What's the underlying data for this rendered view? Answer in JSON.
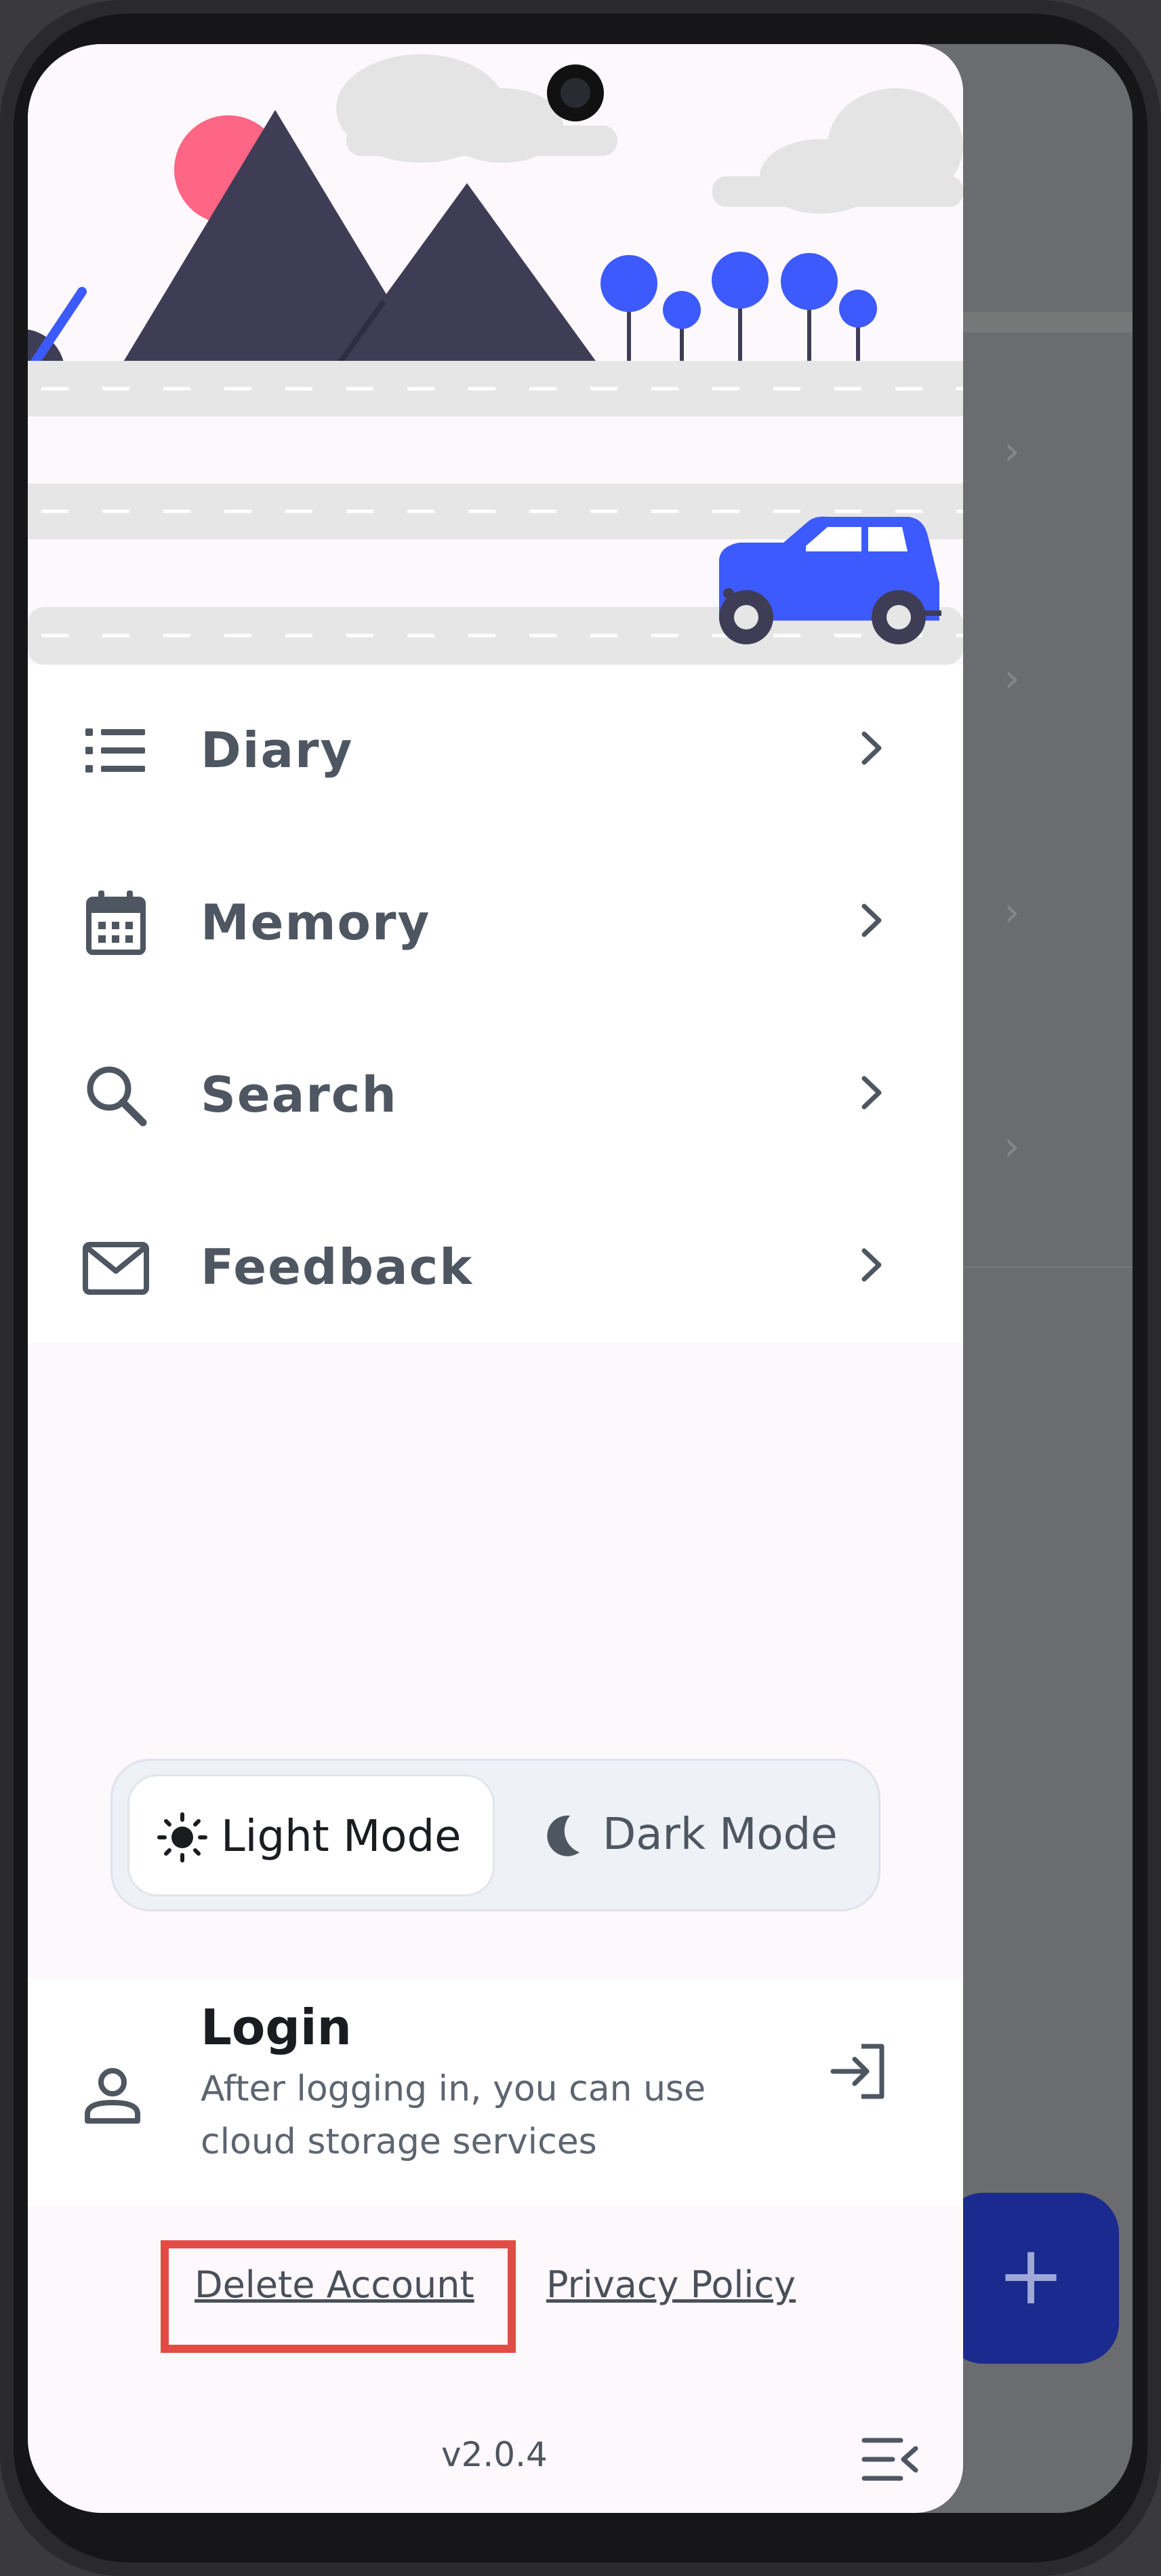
{
  "drawer": {
    "menu": [
      {
        "label": "Diary",
        "icon": "list-icon"
      },
      {
        "label": "Memory",
        "icon": "calendar-icon"
      },
      {
        "label": "Search",
        "icon": "search-icon"
      },
      {
        "label": "Feedback",
        "icon": "mail-icon"
      }
    ],
    "theme": {
      "light_label": "Light Mode",
      "dark_label": "Dark Mode",
      "selected": "Light Mode"
    },
    "login": {
      "title": "Login",
      "subtitle": "After logging in, you can use cloud storage services"
    },
    "links": {
      "delete_account": "Delete Account",
      "privacy_policy": "Privacy Policy"
    },
    "version": "v2.0.4"
  },
  "fab": {
    "label": "+"
  },
  "colors": {
    "accent": "#3d5afe",
    "highlight_box": "#e14d45",
    "mountain": "#3f3d56",
    "sun": "#ff6584"
  }
}
